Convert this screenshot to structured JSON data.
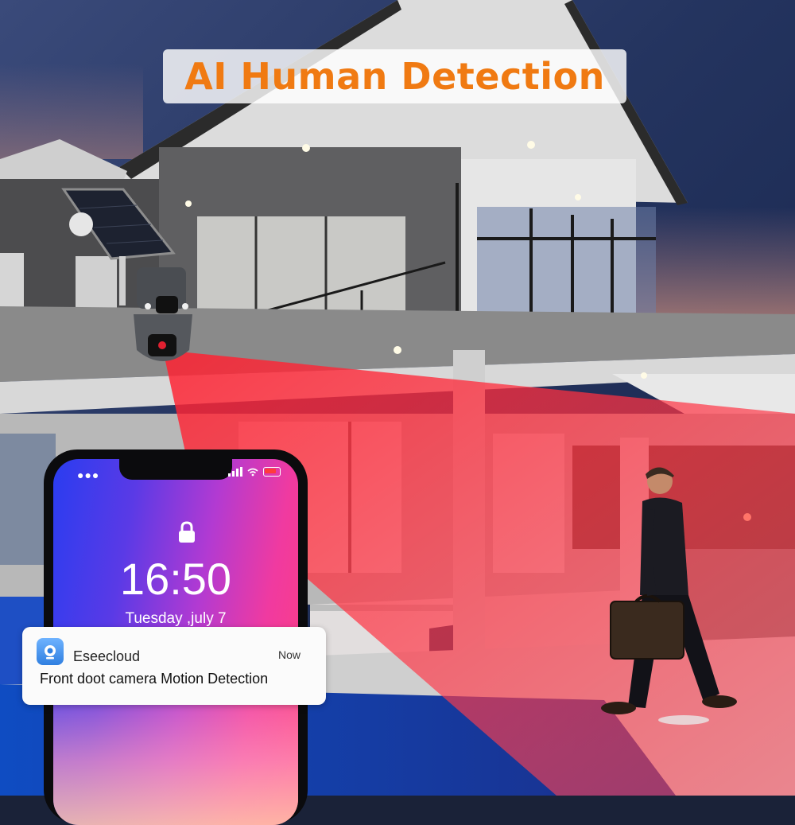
{
  "headline": "AI Human Detection",
  "phone": {
    "lock_time": "16:50",
    "lock_date": "Tuesday ,july 7"
  },
  "notification": {
    "app_name": "Eseecloud",
    "time": "Now",
    "message": "Front doot camera Motion Detection"
  },
  "colors": {
    "headline": "#f07a12",
    "detection_beam": "#ff2e3a"
  }
}
